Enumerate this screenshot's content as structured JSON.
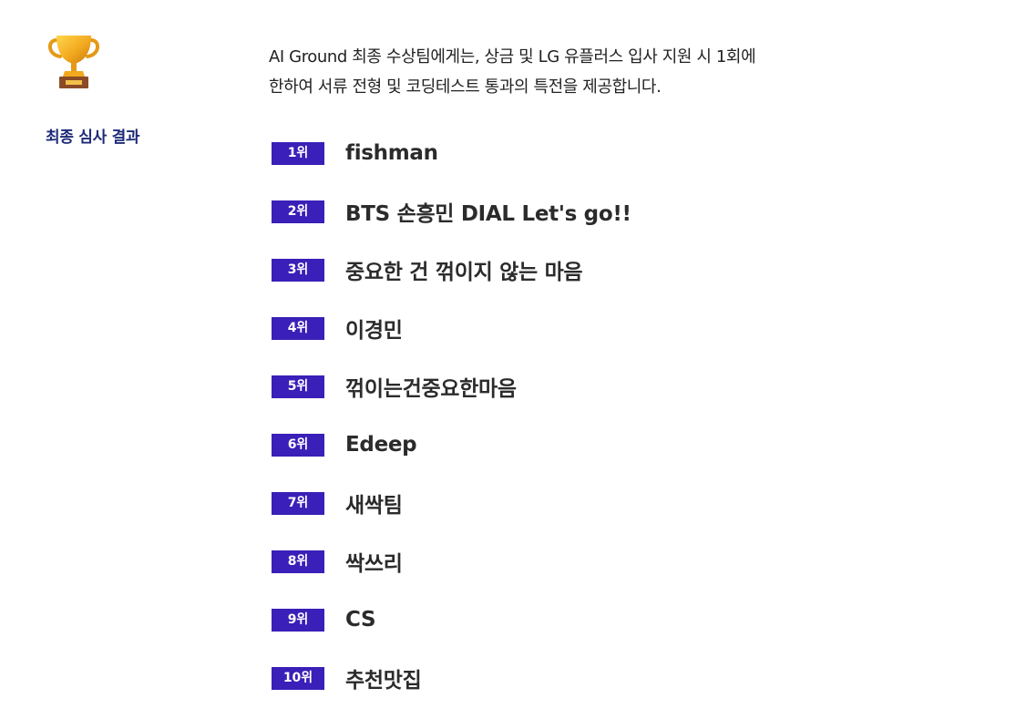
{
  "colors": {
    "badge": "#3a1fb8",
    "section_label": "#1e2a78",
    "text": "#222222"
  },
  "sidebar": {
    "icon": "trophy-icon",
    "section_label": "최종 심사 결과"
  },
  "intro_text": "AI Ground 최종 수상팀에게는, 상금 및 LG 유플러스 입사 지원 시 1회에\n한하여 서류 전형 및 코딩테스트 통과의 특전을 제공합니다.",
  "rankings": [
    {
      "rank": "1위",
      "team": "fishman"
    },
    {
      "rank": "2위",
      "team": "BTS 손흥민 DIAL Let's go!!"
    },
    {
      "rank": "3위",
      "team": "중요한 건 꺾이지 않는 마음"
    },
    {
      "rank": "4위",
      "team": "이경민"
    },
    {
      "rank": "5위",
      "team": "꺾이는건중요한마음"
    },
    {
      "rank": "6위",
      "team": "Edeep"
    },
    {
      "rank": "7위",
      "team": "새싹팀"
    },
    {
      "rank": "8위",
      "team": "싹쓰리"
    },
    {
      "rank": "9위",
      "team": "CS"
    },
    {
      "rank": "10위",
      "team": "추천맛집"
    }
  ]
}
